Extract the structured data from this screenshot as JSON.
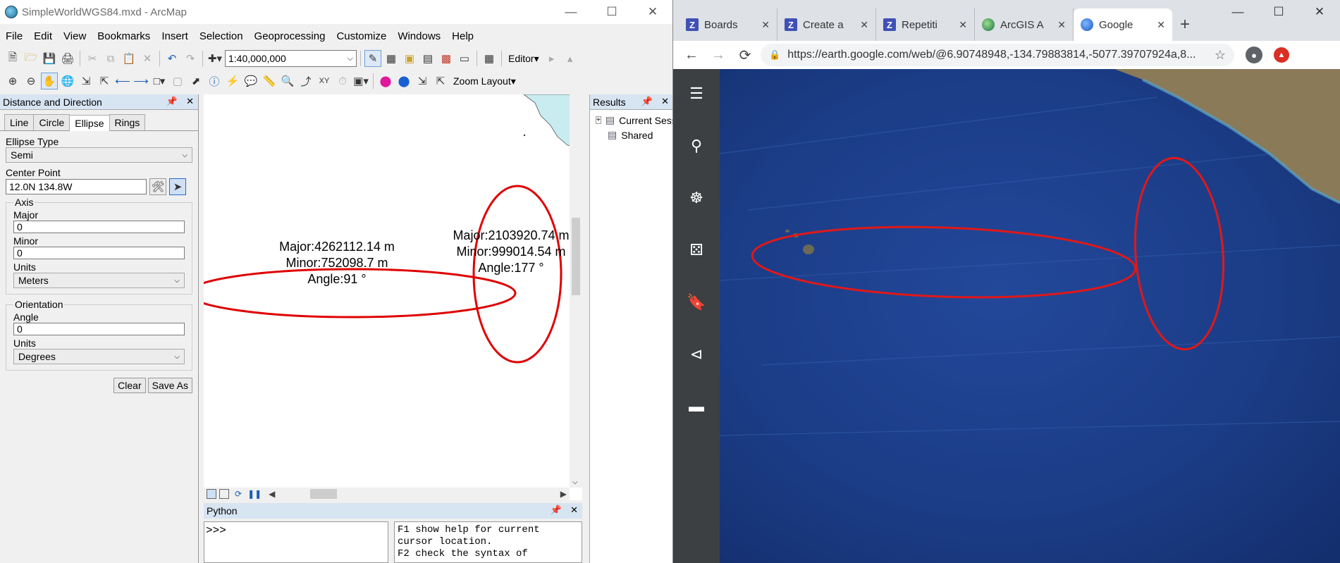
{
  "arcmap": {
    "title": "SimpleWorldWGS84.mxd - ArcMap",
    "menu": [
      "File",
      "Edit",
      "View",
      "Bookmarks",
      "Insert",
      "Selection",
      "Geoprocessing",
      "Customize",
      "Windows",
      "Help"
    ],
    "scale": "1:40,000,000",
    "editor_label": "Editor▾",
    "zoom_layout_label": "Zoom Layout▾"
  },
  "dd_panel": {
    "title": "Distance and Direction",
    "tabs": [
      "Line",
      "Circle",
      "Ellipse",
      "Rings"
    ],
    "active_tab": "Ellipse",
    "ellipse_type_label": "Ellipse Type",
    "ellipse_type_value": "Semi",
    "center_point_label": "Center Point",
    "center_point_value": "12.0N 134.8W",
    "axis_legend": "Axis",
    "major_label": "Major",
    "major_value": "0",
    "minor_label": "Minor",
    "minor_value": "0",
    "axis_units_label": "Units",
    "axis_units_value": "Meters",
    "orientation_legend": "Orientation",
    "angle_label": "Angle",
    "angle_value": "0",
    "orient_units_label": "Units",
    "orient_units_value": "Degrees",
    "clear_label": "Clear",
    "save_as_label": "Save As"
  },
  "map": {
    "ellipse1": {
      "major": "Major:4262112.14 m",
      "minor": "Minor:752098.7 m",
      "angle": "Angle:91 °"
    },
    "ellipse2": {
      "major": "Major:2103920.74 m",
      "minor": "Minor:999014.54 m",
      "angle": "Angle:177 °"
    },
    "ellipse_color": "#e00000"
  },
  "results": {
    "title": "Results",
    "items": [
      "Current Session",
      "Shared"
    ]
  },
  "python": {
    "title": "Python",
    "prompt": ">>>",
    "help_text": "F1 show help for current\ncursor location.\nF2 check the syntax of"
  },
  "chrome": {
    "tabs": [
      {
        "name": "Boards",
        "icon": "z"
      },
      {
        "name": "Create a",
        "icon": "z"
      },
      {
        "name": "Repetiti",
        "icon": "z"
      },
      {
        "name": "ArcGIS A",
        "icon": "globe"
      },
      {
        "name": "Google",
        "icon": "earth"
      }
    ],
    "active_tab": "Google",
    "url": "https://earth.google.com/web/@6.90748948,-134.79883814,-5077.39707924a,8..."
  },
  "earth": {
    "sidebar_icons": [
      "menu-icon",
      "search-icon",
      "voyager-icon",
      "feeling-lucky-icon",
      "projects-icon",
      "share-icon",
      "measure-icon"
    ],
    "ocean_color": "#1c3f8c",
    "ellipse_color": "#e01818"
  }
}
